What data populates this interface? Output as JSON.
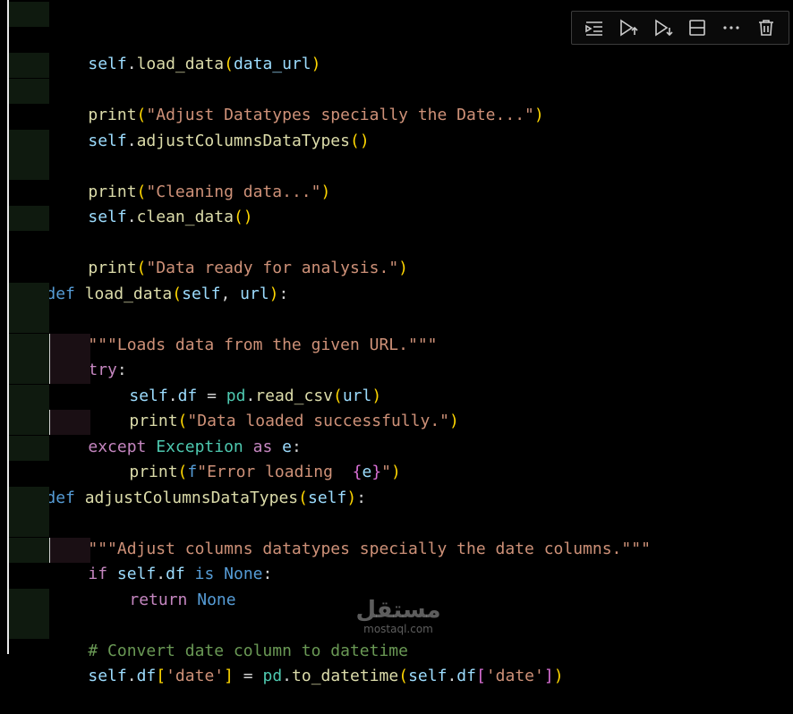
{
  "toolbar": {
    "buttons": [
      {
        "icon": "execute-above-icon"
      },
      {
        "icon": "run-above-icon"
      },
      {
        "icon": "run-below-icon"
      },
      {
        "icon": "split-cell-icon"
      },
      {
        "icon": "more-icon"
      },
      {
        "icon": "delete-icon"
      }
    ]
  },
  "code": {
    "l1": {
      "a": "self",
      "b": ".",
      "c": "load_data",
      "d": "(",
      "e": "data_url",
      "f": ")"
    },
    "l3": {
      "a": "print",
      "b": "(",
      "c": "\"Adjust Datatypes specially the Date...\"",
      "d": ")"
    },
    "l4": {
      "a": "self",
      "b": ".",
      "c": "adjustColumnsDataTypes",
      "d": "()"
    },
    "l6": {
      "a": "print",
      "b": "(",
      "c": "\"Cleaning data...\"",
      "d": ")"
    },
    "l7": {
      "a": "self",
      "b": ".",
      "c": "clean_data",
      "d": "()"
    },
    "l9": {
      "a": "print",
      "b": "(",
      "c": "\"Data ready for analysis.\"",
      "d": ")"
    },
    "l11": {
      "a": "def",
      "b": " ",
      "c": "load_data",
      "d": "(",
      "e": "self",
      "f": ", ",
      "g": "url",
      "h": ")",
      "i": ":"
    },
    "l12": {
      "a": "\"\"\"Loads data from the given URL.\"\"\""
    },
    "l13": {
      "a": "try",
      "b": ":"
    },
    "l14": {
      "a": "self",
      "b": ".",
      "c": "df",
      "d": " = ",
      "e": "pd",
      "f": ".",
      "g": "read_csv",
      "h": "(",
      "i": "url",
      "j": ")"
    },
    "l15": {
      "a": "print",
      "b": "(",
      "c": "\"Data loaded successfully.\"",
      "d": ")"
    },
    "l16": {
      "a": "except",
      "b": " ",
      "c": "Exception",
      "d": " ",
      "e": "as",
      "f": " ",
      "g": "e",
      "h": ":"
    },
    "l17": {
      "a": "print",
      "b": "(",
      "c": "f",
      "d": "\"Error loading  ",
      "e": "{",
      "f": "e",
      "g": "}",
      "h": "\"",
      "i": ")"
    },
    "l19": {
      "a": "def",
      "b": " ",
      "c": "adjustColumnsDataTypes",
      "d": "(",
      "e": "self",
      "f": ")",
      "g": ":"
    },
    "l20": {
      "a": "\"\"\"Adjust columns datatypes specially the date columns.\"\"\""
    },
    "l21": {
      "a": "if",
      "b": " ",
      "c": "self",
      "d": ".",
      "e": "df",
      "f": " ",
      "g": "is",
      "h": " ",
      "i": "None",
      "j": ":"
    },
    "l22": {
      "a": "return",
      "b": " ",
      "c": "None"
    },
    "l24": {
      "a": "# Convert date column to datetime"
    },
    "l25": {
      "a": "self",
      "b": ".",
      "c": "df",
      "d": "[",
      "e": "'date'",
      "f": "]",
      "g": " = ",
      "h": "pd",
      "i": ".",
      "j": "to_datetime",
      "k": "(",
      "l": "self",
      "m": ".",
      "n": "df",
      "o": "[",
      "p": "'date'",
      "q": "]",
      "r": ")"
    }
  },
  "watermark": {
    "main": "مستقل",
    "sub": "mostaql.com"
  }
}
